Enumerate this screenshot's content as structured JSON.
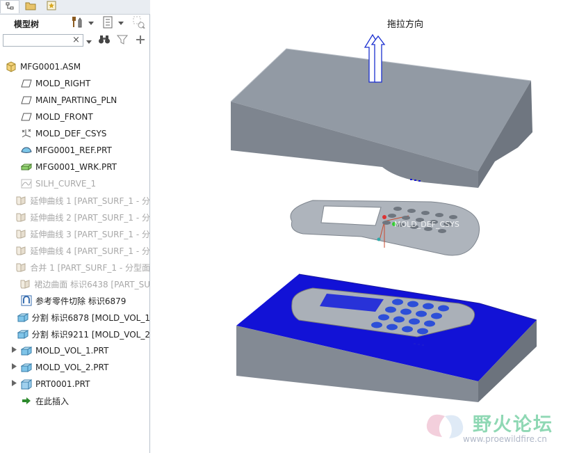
{
  "tabs": [
    {
      "name": "model-tree-tab",
      "icon": "tree-icon",
      "active": true
    },
    {
      "name": "folder-tab",
      "icon": "folder-icon",
      "active": false
    },
    {
      "name": "favorites-tab",
      "icon": "star-icon",
      "active": false
    }
  ],
  "toolbar": {
    "title": "模型树",
    "buttons": [
      "tools-icon",
      "chevron-down-icon",
      "settings-icon",
      "chevron-down-icon",
      "show-icon"
    ]
  },
  "search": {
    "value": "",
    "placeholder": "",
    "clear": "×"
  },
  "tree": {
    "root": "MFG0001.ASM",
    "items": [
      {
        "label": "MOLD_RIGHT",
        "icon": "datum-plane-icon",
        "dim": false,
        "expandable": false
      },
      {
        "label": "MAIN_PARTING_PLN",
        "icon": "datum-plane-icon",
        "dim": false,
        "expandable": false
      },
      {
        "label": "MOLD_FRONT",
        "icon": "datum-plane-icon",
        "dim": false,
        "expandable": false
      },
      {
        "label": "MOLD_DEF_CSYS",
        "icon": "csys-icon",
        "dim": false,
        "expandable": false
      },
      {
        "label": "MFG0001_REF.PRT",
        "icon": "ref-part-icon",
        "dim": false,
        "expandable": false
      },
      {
        "label": "MFG0001_WRK.PRT",
        "icon": "workpiece-icon",
        "dim": false,
        "expandable": false
      },
      {
        "label": "SILH_CURVE_1",
        "icon": "curve-icon",
        "dim": true,
        "expandable": false
      },
      {
        "label": "延伸曲线 1 [PART_SURF_1 - 分",
        "icon": "surface-icon",
        "dim": true,
        "expandable": false
      },
      {
        "label": "延伸曲线 2 [PART_SURF_1 - 分",
        "icon": "surface-icon",
        "dim": true,
        "expandable": false
      },
      {
        "label": "延伸曲线 3 [PART_SURF_1 - 分",
        "icon": "surface-icon",
        "dim": true,
        "expandable": false
      },
      {
        "label": "延伸曲线 4 [PART_SURF_1 - 分",
        "icon": "surface-icon",
        "dim": true,
        "expandable": false
      },
      {
        "label": "合并 1 [PART_SURF_1 - 分型面",
        "icon": "surface-icon",
        "dim": true,
        "expandable": false
      },
      {
        "label": "裙边曲面 标识6438 [PART_SU",
        "icon": "surface-icon",
        "dim": true,
        "expandable": false
      },
      {
        "label": "参考零件切除 标识6879",
        "icon": "cutout-icon",
        "dim": false,
        "expandable": false
      },
      {
        "label": "分割 标识6878 [MOLD_VOL_1",
        "icon": "split-icon",
        "dim": false,
        "expandable": false
      },
      {
        "label": "分割 标识9211 [MOLD_VOL_2",
        "icon": "split-icon",
        "dim": false,
        "expandable": false
      },
      {
        "label": "MOLD_VOL_1.PRT",
        "icon": "volume-icon",
        "dim": false,
        "expandable": true
      },
      {
        "label": "MOLD_VOL_2.PRT",
        "icon": "volume-icon",
        "dim": false,
        "expandable": true
      },
      {
        "label": "PRT0001.PRT",
        "icon": "part-icon",
        "dim": false,
        "expandable": true
      },
      {
        "label": "在此插入",
        "icon": "insert-arrow-icon",
        "dim": false,
        "expandable": false
      }
    ]
  },
  "viewport": {
    "drag_direction_label": "拖拉方向",
    "csys_label": "MOLD_DEF_CSYS"
  },
  "watermark": {
    "main": "野火论坛",
    "url": "www.proewildfire.cn"
  },
  "colors": {
    "mold_gray": "#8e959e",
    "parting_blue": "#1010d8",
    "part_gray": "#aeb4bc",
    "key_blue": "#2d4fd8"
  }
}
